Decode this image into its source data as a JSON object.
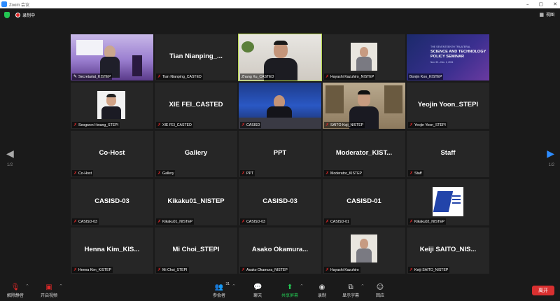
{
  "window": {
    "title": "Zoom 会议",
    "controls": [
      "–",
      "▢",
      "✕"
    ]
  },
  "status": {
    "recording_label": "录制中",
    "view_label": "视图"
  },
  "pagination": {
    "left": "1/2",
    "right": "1/2"
  },
  "tiles": [
    {
      "big": "",
      "label": "Secretariat_KISTEP",
      "mic": "pin"
    },
    {
      "big": "Tian  Nianping_...",
      "label": "Tian Nianping_CASTED",
      "mic": "muted"
    },
    {
      "big": "",
      "label": "Zhang Xu_CASTED",
      "mic": "none"
    },
    {
      "big": "",
      "label": "Hayashi Kazuhiro_NISTEP",
      "mic": "muted"
    },
    {
      "big": "",
      "label": "Bonjin Koo_KISTEP",
      "mic": "none"
    },
    {
      "big": "",
      "label": "Seogwon Hwang_STEPI",
      "mic": "muted"
    },
    {
      "big": "XIE FEI_CASTED",
      "label": "XIE FEI_CASTED",
      "mic": "muted"
    },
    {
      "big": "",
      "label": "CASISD",
      "mic": "muted"
    },
    {
      "big": "",
      "label": "SAITO Koji_NISTEP",
      "mic": "muted"
    },
    {
      "big": "Yeojin Yoon_STEPI",
      "label": "Yeojin Yoon_STEPI",
      "mic": "muted"
    },
    {
      "big": "Co-Host",
      "label": "Co-Host",
      "mic": "muted"
    },
    {
      "big": "Gallery",
      "label": "Gallery",
      "mic": "muted"
    },
    {
      "big": "PPT",
      "label": "PPT",
      "mic": "muted"
    },
    {
      "big": "Moderator_KIST...",
      "label": "Moderator_KISTEP",
      "mic": "muted"
    },
    {
      "big": "Staff",
      "label": "Staff",
      "mic": "muted"
    },
    {
      "big": "CASISD-03",
      "label": "CASISD-03",
      "mic": "muted"
    },
    {
      "big": "Kikaku01_NISTEP",
      "label": "Kikaku01_NISTEP",
      "mic": "muted"
    },
    {
      "big": "CASISD-03",
      "label": "CASISD-03",
      "mic": "muted"
    },
    {
      "big": "CASISD-01",
      "label": "CASISD-01",
      "mic": "muted"
    },
    {
      "big": "",
      "label": "Kikaku02_NISTEP",
      "mic": "muted"
    },
    {
      "big": "Henna  Kim_KIS...",
      "label": "Henna Kim_KISTEP",
      "mic": "muted"
    },
    {
      "big": "Mi Choi_STEPI",
      "label": "Mi Choi_STEPI",
      "mic": "muted"
    },
    {
      "big": "Asako  Okamura...",
      "label": "Asako Okamura_NISTEP",
      "mic": "muted"
    },
    {
      "big": "",
      "label": "Hayashi Kazuhiro",
      "mic": "muted"
    },
    {
      "big": "Keiji  SAITO_NIS...",
      "label": "Keiji SAITO_NISTEP",
      "mic": "muted"
    }
  ],
  "seminar_slide": {
    "line1": "THE SEVENTEENTH TRILATERAL",
    "line2": "SCIENCE AND TECHNOLOGY",
    "line3": "POLICY SEMINAR",
    "date": "Nov. 30 – Dec. 1, 2021"
  },
  "toolbar": {
    "unmute": "解除静音",
    "start_video": "开启视频",
    "participants": "参会者",
    "participants_count": "31",
    "chat": "聊天",
    "share_screen": "共享屏幕",
    "record": "录制",
    "captions": "显示字幕",
    "reactions": "回应",
    "leave": "离开"
  }
}
